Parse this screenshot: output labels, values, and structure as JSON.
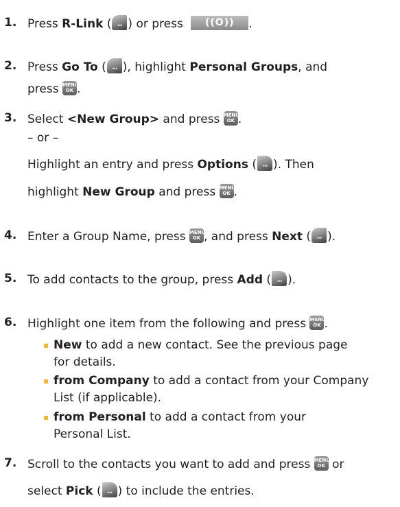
{
  "steps": [
    {
      "number": "1.",
      "lines": [
        {
          "parts": [
            "Press ",
            "R-Link",
            " (",
            ") or press ",
            "."
          ]
        }
      ]
    },
    {
      "number": "2.",
      "lines": [
        {
          "parts": [
            "Press ",
            "Go To",
            " (",
            "), highlight ",
            "Personal Groups",
            ", and"
          ]
        },
        {
          "parts": [
            "press ",
            "."
          ]
        }
      ]
    },
    {
      "number": "3.",
      "lines": [
        {
          "parts": [
            "Select ",
            "<New Group>",
            " and press ",
            "."
          ]
        },
        {
          "parts": [
            "– or –"
          ]
        },
        {
          "parts": [
            "Highlight an entry and press ",
            "Options",
            " (",
            "). Then"
          ]
        },
        {
          "parts": [
            "highlight ",
            "New Group",
            " and press ",
            "."
          ]
        }
      ]
    },
    {
      "number": "4.",
      "lines": [
        {
          "parts": [
            "Enter a Group Name, press ",
            ", and press ",
            "Next",
            " (",
            ")."
          ]
        }
      ]
    },
    {
      "number": "5.",
      "lines": [
        {
          "parts": [
            "To add contacts to the group, press ",
            "Add",
            " (",
            ")."
          ]
        }
      ]
    },
    {
      "number": "6.",
      "lines": [
        {
          "parts": [
            "Highlight one item from the following and press ",
            "."
          ]
        }
      ],
      "bullets": [
        {
          "bold": "New",
          "text": " to add a new contact. See the previous page",
          "cont": "for details."
        },
        {
          "bold": "from Company",
          "text": " to add a contact from your Company",
          "cont": "List (if applicable)."
        },
        {
          "bold": "from Personal",
          "text": " to add a contact from your",
          "cont": "Personal List."
        }
      ]
    },
    {
      "number": "7.",
      "lines": [
        {
          "parts": [
            "Scroll to the contacts you want to add and press ",
            " or"
          ]
        },
        {
          "parts": [
            "select ",
            "Pick",
            " (",
            ") to include the entries."
          ]
        }
      ]
    }
  ],
  "icons": {
    "menu_ok_top": "MENU",
    "menu_ok_bottom": "OK",
    "softkey_dots": "···",
    "nav_key_label": "((O))"
  },
  "colors": {
    "text": "#231f20",
    "bullet": "#f2b632"
  }
}
